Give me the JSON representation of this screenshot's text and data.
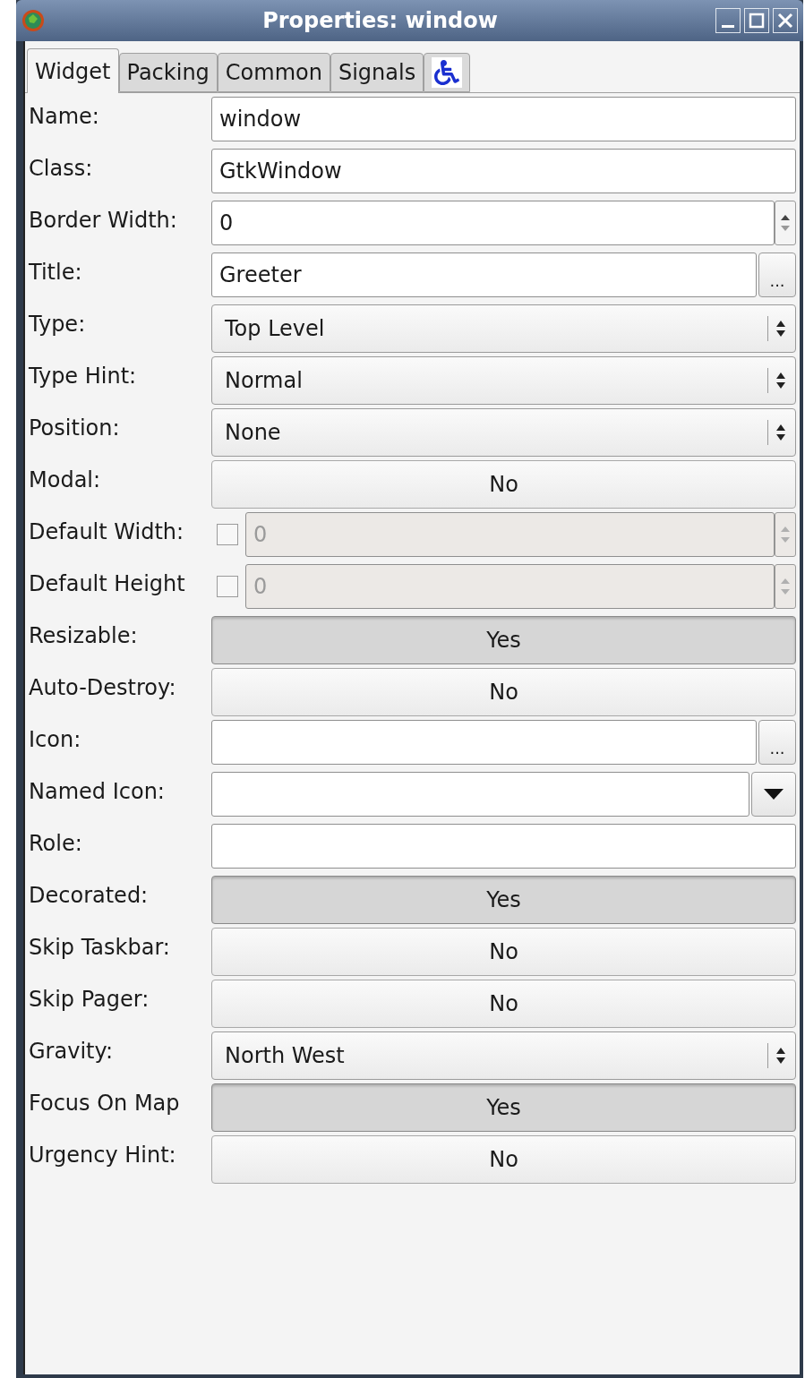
{
  "window": {
    "title": "Properties: window"
  },
  "tabs": [
    {
      "kind": "text",
      "label": "Widget",
      "selected": true
    },
    {
      "kind": "text",
      "label": "Packing",
      "selected": false
    },
    {
      "kind": "text",
      "label": "Common",
      "selected": false
    },
    {
      "kind": "text",
      "label": "Signals",
      "selected": false
    },
    {
      "kind": "icon",
      "selected": false
    }
  ],
  "properties": [
    {
      "label": "Name:",
      "kind": "text",
      "value": "window"
    },
    {
      "label": "Class:",
      "kind": "text",
      "value": "GtkWindow"
    },
    {
      "label": "Border Width:",
      "kind": "spin",
      "value": "0"
    },
    {
      "label": "Title:",
      "kind": "text_button",
      "value": "Greeter",
      "button": "..."
    },
    {
      "label": "Type:",
      "kind": "combo",
      "value": "Top Level"
    },
    {
      "label": "Type Hint:",
      "kind": "combo",
      "value": "Normal"
    },
    {
      "label": "Position:",
      "kind": "combo",
      "value": "None"
    },
    {
      "label": "Modal:",
      "kind": "toggle",
      "value": "No",
      "on": false
    },
    {
      "label": "Default Width:",
      "kind": "check_spin",
      "value": "0",
      "checked": false
    },
    {
      "label": "Default Height",
      "kind": "check_spin",
      "value": "0",
      "checked": false
    },
    {
      "label": "Resizable:",
      "kind": "toggle",
      "value": "Yes",
      "on": true
    },
    {
      "label": "Auto-Destroy:",
      "kind": "toggle",
      "value": "No",
      "on": false
    },
    {
      "label": "Icon:",
      "kind": "text_button",
      "button": "..."
    },
    {
      "label": "Named Icon:",
      "kind": "combo_entry"
    },
    {
      "label": "Role:",
      "kind": "text"
    },
    {
      "label": "Decorated:",
      "kind": "toggle",
      "value": "Yes",
      "on": true
    },
    {
      "label": "Skip Taskbar:",
      "kind": "toggle",
      "value": "No",
      "on": false
    },
    {
      "label": "Skip Pager:",
      "kind": "toggle",
      "value": "No",
      "on": false
    },
    {
      "label": "Gravity:",
      "kind": "combo",
      "value": "North West"
    },
    {
      "label": "Focus On Map",
      "kind": "toggle",
      "value": "Yes",
      "on": true
    },
    {
      "label": "Urgency Hint:",
      "kind": "toggle",
      "value": "No",
      "on": false
    }
  ]
}
